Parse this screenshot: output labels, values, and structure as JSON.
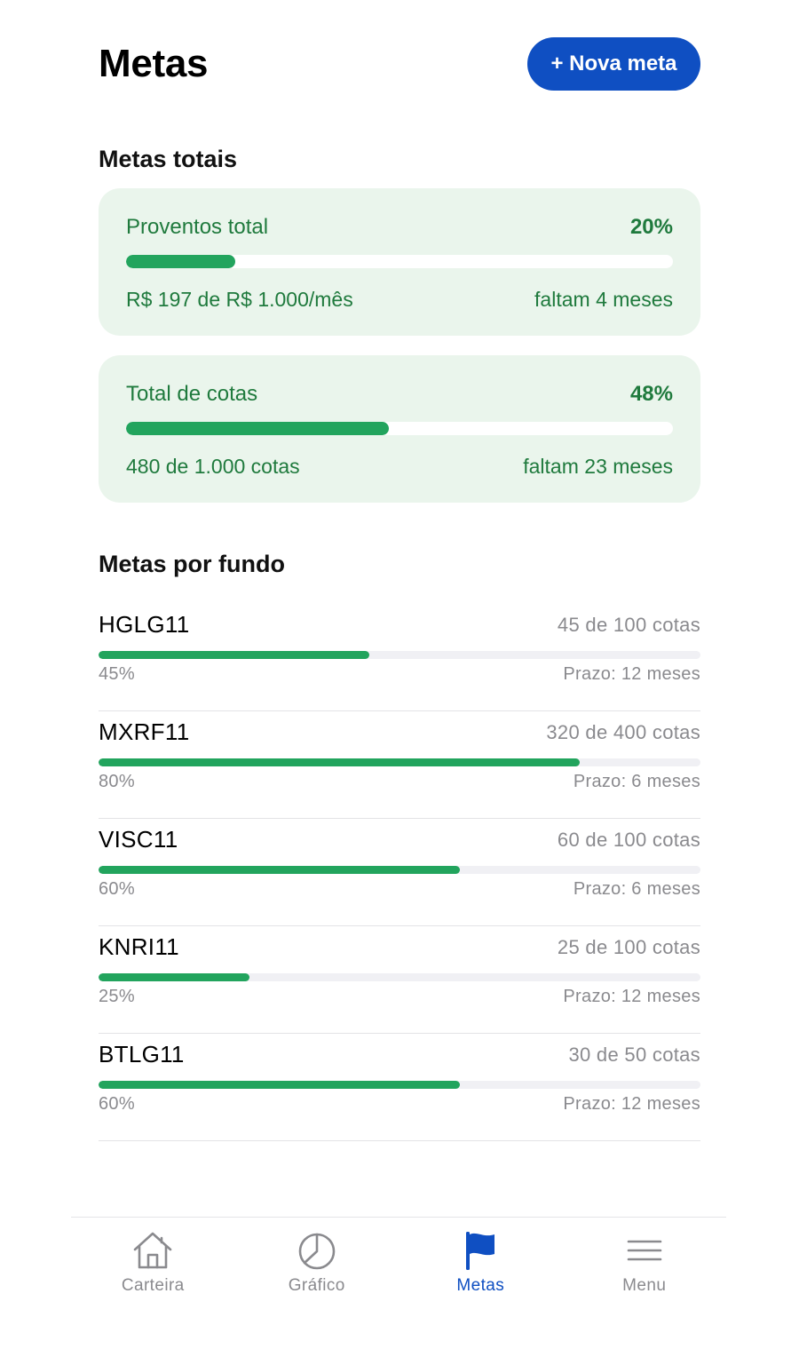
{
  "header": {
    "title": "Metas",
    "new_goal_label": "+ Nova meta"
  },
  "totals": {
    "section_title": "Metas totais",
    "cards": [
      {
        "label": "Proventos total",
        "percent_label": "20%",
        "progress": 0.2,
        "summary": "R$ 197 de R$ 1.000/mês",
        "remaining": "faltam 4 meses"
      },
      {
        "label": "Total de cotas",
        "percent_label": "48%",
        "progress": 0.48,
        "summary": "480 de 1.000 cotas",
        "remaining": "faltam 23 meses"
      }
    ]
  },
  "funds": {
    "section_title": "Metas por fundo",
    "items": [
      {
        "ticker": "HGLG11",
        "count": "45 de 100 cotas",
        "percent_label": "45%",
        "progress": 0.45,
        "deadline": "Prazo: 12 meses"
      },
      {
        "ticker": "MXRF11",
        "count": "320 de 400 cotas",
        "percent_label": "80%",
        "progress": 0.8,
        "deadline": "Prazo: 6 meses"
      },
      {
        "ticker": "VISC11",
        "count": "60 de 100 cotas",
        "percent_label": "60%",
        "progress": 0.6,
        "deadline": "Prazo: 6 meses"
      },
      {
        "ticker": "KNRI11",
        "count": "25 de 100 cotas",
        "percent_label": "25%",
        "progress": 0.25,
        "deadline": "Prazo: 12 meses"
      },
      {
        "ticker": "BTLG11",
        "count": "30 de 50 cotas",
        "percent_label": "60%",
        "progress": 0.6,
        "deadline": "Prazo: 12 meses"
      }
    ]
  },
  "nav": {
    "items": [
      {
        "label": "Carteira",
        "icon": "home-icon",
        "active": false
      },
      {
        "label": "Gráfico",
        "icon": "pie-chart-icon",
        "active": false
      },
      {
        "label": "Metas",
        "icon": "flag-icon",
        "active": true
      },
      {
        "label": "Menu",
        "icon": "hamburger-menu-icon",
        "active": false
      }
    ]
  },
  "colors": {
    "accent": "#0f4fc2",
    "progress_green": "#22a45d",
    "card_bg": "#eaf5ec",
    "card_text": "#1f7a3d",
    "muted": "#8a8a8e"
  }
}
